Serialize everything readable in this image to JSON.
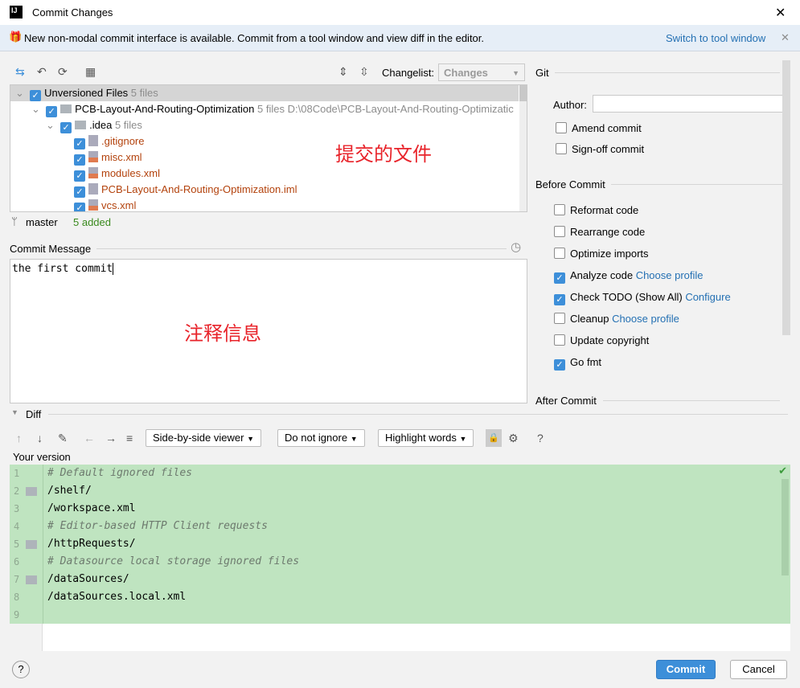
{
  "window": {
    "title": "Commit Changes",
    "close": "✕"
  },
  "banner": {
    "text": "New non-modal commit interface is available. Commit from a tool window and view diff in the editor.",
    "link": "Switch to tool window",
    "close": "✕"
  },
  "toolbar": {
    "changelist_label": "Changelist:",
    "changelist_value": "Changes"
  },
  "tree": [
    {
      "label": "Unversioned Files",
      "count": "5 files"
    },
    {
      "label": "PCB-Layout-And-Routing-Optimization",
      "count": "5 files",
      "path": "D:\\08Code\\PCB-Layout-And-Routing-Optimizatic"
    },
    {
      "label": ".idea",
      "count": "5 files"
    },
    {
      "label": ".gitignore"
    },
    {
      "label": "misc.xml"
    },
    {
      "label": "modules.xml"
    },
    {
      "label": "PCB-Layout-And-Routing-Optimization.iml"
    },
    {
      "label": "vcs.xml"
    }
  ],
  "annotation_files": "提交的文件",
  "status": {
    "branch": "master",
    "added": "5 added"
  },
  "commit_message": {
    "label": "Commit Message",
    "value": "the first commit",
    "annotation": "注释信息"
  },
  "git": {
    "title": "Git",
    "author_label": "Author:",
    "author_value": "",
    "amend": "Amend commit",
    "signoff": "Sign-off commit"
  },
  "before_commit": {
    "title": "Before Commit",
    "items": [
      {
        "label": "Reformat code",
        "checked": false
      },
      {
        "label": "Rearrange code",
        "checked": false
      },
      {
        "label": "Optimize imports",
        "checked": false
      },
      {
        "label": "Analyze code",
        "link": "Choose profile",
        "checked": true
      },
      {
        "label": "Check TODO (Show All)",
        "link": "Configure",
        "checked": true
      },
      {
        "label": "Cleanup",
        "link": "Choose profile",
        "checked": false
      },
      {
        "label": "Update copyright",
        "checked": false
      },
      {
        "label": "Go fmt",
        "checked": true
      }
    ]
  },
  "after_commit": {
    "title": "After Commit"
  },
  "diff": {
    "title": "Diff",
    "viewer": "Side-by-side viewer",
    "ignore": "Do not ignore",
    "highlight": "Highlight words",
    "help": "?",
    "version_label": "Your version",
    "lines": [
      {
        "n": "1",
        "text": "# Default ignored files",
        "comment": true
      },
      {
        "n": "2",
        "text": "/shelf/",
        "folder": true
      },
      {
        "n": "3",
        "text": "/workspace.xml"
      },
      {
        "n": "4",
        "text": "# Editor-based HTTP Client requests",
        "comment": true
      },
      {
        "n": "5",
        "text": "/httpRequests/",
        "folder": true
      },
      {
        "n": "6",
        "text": "# Datasource local storage ignored files",
        "comment": true
      },
      {
        "n": "7",
        "text": "/dataSources/",
        "folder": true
      },
      {
        "n": "8",
        "text": "/dataSources.local.xml"
      },
      {
        "n": "9",
        "text": ""
      }
    ]
  },
  "buttons": {
    "help": "?",
    "commit": "Commit",
    "cancel": "Cancel"
  },
  "colors": {
    "accent": "#3d8fd9",
    "diff_added": "#bfe4c0",
    "annotation": "#e8232a"
  }
}
